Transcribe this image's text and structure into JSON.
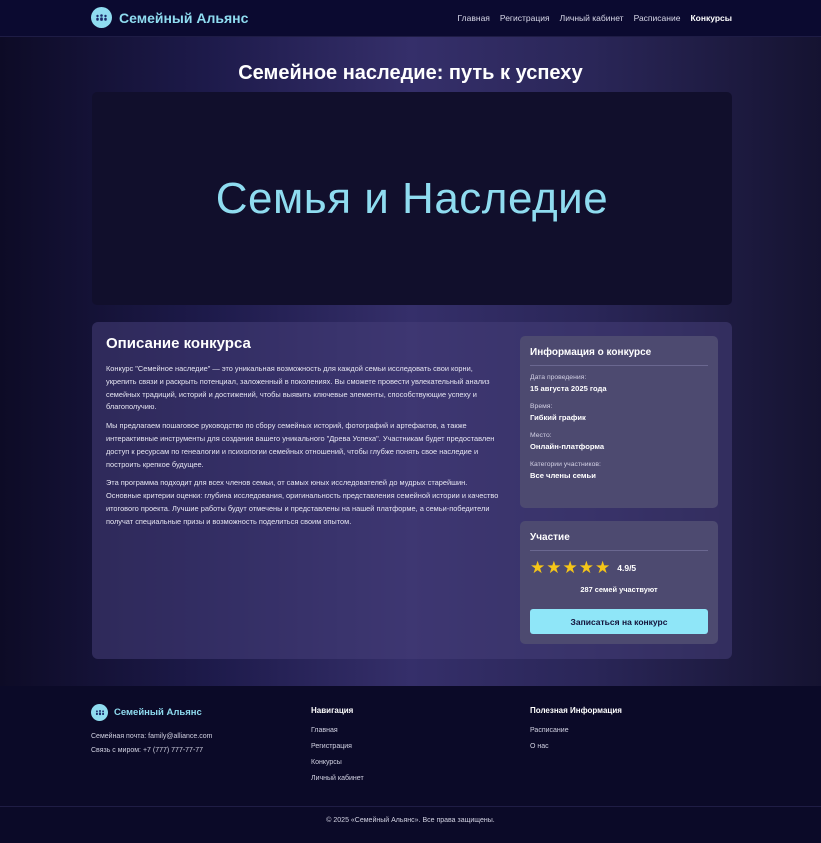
{
  "brand": {
    "name": "Семейный Альянс",
    "accent": "#8fdcf0"
  },
  "nav": {
    "items": [
      {
        "label": "Главная"
      },
      {
        "label": "Регистрация"
      },
      {
        "label": "Личный кабинет"
      },
      {
        "label": "Расписание"
      },
      {
        "label": "Конкурсы"
      }
    ],
    "active": "Конкурсы"
  },
  "page": {
    "title": "Семейное наследие: путь к успеху"
  },
  "hero": {
    "text": "Семья и Наследие"
  },
  "description": {
    "heading": "Описание конкурса",
    "paragraphs": [
      "Конкурс \"Семейное наследие\" — это уникальная возможность для каждой семьи исследовать свои корни, укрепить связи и раскрыть потенциал, заложенный в поколениях. Вы сможете провести увлекательный анализ семейных традиций, историй и достижений, чтобы выявить ключевые элементы, способствующие успеху и благополучию.",
      "Мы предлагаем пошаговое руководство по сбору семейных историй, фотографий и артефактов, а также интерактивные инструменты для создания вашего уникального \"Древа Успеха\". Участникам будет предоставлен доступ к ресурсам по генеалогии и психологии семейных отношений, чтобы глубже понять свое наследие и построить крепкое будущее.",
      "Эта программа подходит для всех членов семьи, от самых юных исследователей до мудрых старейшин. Основные критерии оценки: глубина исследования, оригинальность представления семейной истории и качество итогового проекта. Лучшие работы будут отмечены и представлены на нашей платформе, а семьи-победители получат специальные призы и возможность поделиться своим опытом."
    ]
  },
  "info": {
    "heading": "Информация о конкурсе",
    "fields": [
      {
        "label": "Дата проведения:",
        "value": "15 августа 2025 года"
      },
      {
        "label": "Время:",
        "value": "Гибкий график"
      },
      {
        "label": "Место:",
        "value": "Онлайн-платформа"
      },
      {
        "label": "Категории участников:",
        "value": "Все члены семьи"
      }
    ]
  },
  "participation": {
    "heading": "Участие",
    "stars": 5,
    "rating_text": "4.9/5",
    "participants_text": "287 семей участвуют",
    "button_label": "Записаться на конкурс",
    "star_color": "#f5c518",
    "button_color": "#8fe6f8"
  },
  "footer": {
    "brand": "Семейный Альянс",
    "email_line": "Семейная почта: family@alliance.com",
    "phone_line": "Связь с миром: +7 (777) 777-77-77",
    "nav_heading": "Навигация",
    "nav_links": [
      "Главная",
      "Регистрация",
      "Конкурсы",
      "Личный кабинет"
    ],
    "info_heading": "Полезная Информация",
    "info_links": [
      "Расписание",
      "О нас"
    ],
    "copyright": "© 2025 «Семейный Альянс». Все права защищены."
  }
}
